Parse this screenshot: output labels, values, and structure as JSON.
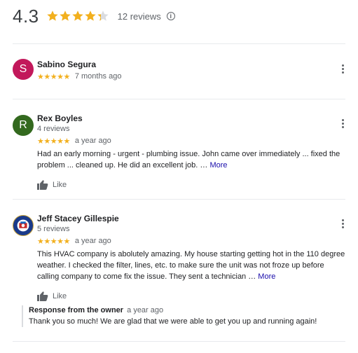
{
  "summary": {
    "rating": "4.3",
    "stars_value": 4.3,
    "review_count": "12 reviews",
    "info_icon": "i"
  },
  "reviews": [
    {
      "initial": "S",
      "avatar_color": "#c2185b",
      "name": "Sabino Segura",
      "subline": "",
      "stars": "★★★★★",
      "time": "7 months ago",
      "text": "",
      "more": ""
    },
    {
      "initial": "R",
      "avatar_color": "#33691e",
      "name": "Rex Boyles",
      "subline": "4 reviews",
      "stars": "★★★★★",
      "time": "a year ago",
      "text": "Had an early morning - urgent - plumbing issue. John came over immediately ... fixed the problem ... cleaned up. He did an excellent job. …",
      "more": "More",
      "like": "Like"
    },
    {
      "initial": "",
      "avatar_color": "#1a3a8a",
      "name": "Jeff Stacey Gillespie",
      "subline": "5 reviews",
      "stars": "★★★★★",
      "time": "a year ago",
      "text": "This HVAC company is abolutely amazing. My house starting getting hot in the 110 degree weather. I checked the filter, lines, etc. to make sure the unit was not froze up before calling company to come fix the issue. They sent a technician …",
      "more": "More",
      "like": "Like",
      "owner": {
        "label": "Response from the owner",
        "time": "a year ago",
        "text": "Thank you so much! We are glad that we were able to get you up and running again!"
      }
    }
  ],
  "colors": {
    "star": "#f2b01e",
    "link": "#1a0dab",
    "muted": "#5f6368"
  }
}
